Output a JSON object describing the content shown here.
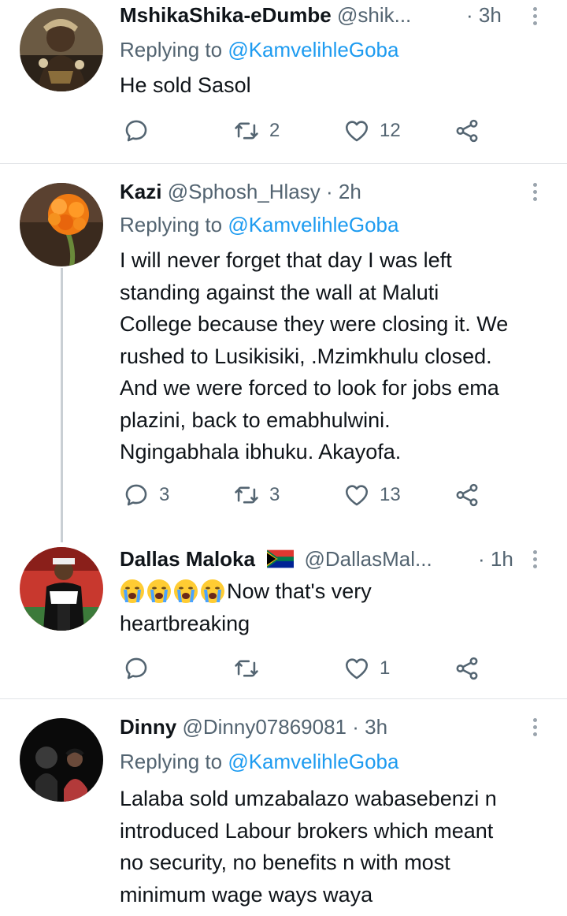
{
  "tweets": [
    {
      "name": "MshikaShika-eDumbe",
      "handle": "@shik...",
      "time": "· 3h",
      "replying_label": "Replying to",
      "replying_to": "@KamvelihleGoba",
      "text": "He sold Sasol",
      "reply_count": "",
      "retweet_count": "2",
      "like_count": "12"
    },
    {
      "name": "Kazi",
      "handle": "@Sphosh_Hlasy",
      "time": "· 2h",
      "replying_label": "Replying to",
      "replying_to": "@KamvelihleGoba",
      "text_lines": [
        "I will never forget that day I was left",
        "standing against the wall at Maluti",
        "College because they were closing it. We",
        "rushed to Lusikisiki, .Mzimkhulu closed.",
        "And we were forced to look for  jobs ema",
        "plazini, back to emabhulwini.",
        "Ngingabhala ibhuku. Akayofa."
      ],
      "reply_count": "3",
      "retweet_count": "3",
      "like_count": "13"
    },
    {
      "name": "Dallas Maloka",
      "handle": "@DallasMal...",
      "time": "· 1h",
      "text_after_emoji": "Now that's very",
      "text_line2": "heartbreaking",
      "reply_count": "",
      "retweet_count": "",
      "like_count": "1"
    },
    {
      "name": "Dinny",
      "handle": "@Dinny07869081",
      "time": "· 3h",
      "replying_label": "Replying to",
      "replying_to": "@KamvelihleGoba",
      "text_lines": [
        "Lalaba sold umzabalazo wabasebenzi n",
        "introduced Labour brokers which meant",
        "no security, no benefits n with most",
        "minimum wage ways waya"
      ]
    }
  ],
  "colors": {
    "text": "#0f1419",
    "secondary": "#536471",
    "link": "#1d9bf0",
    "divider": "#e1e4e7",
    "thread_line": "#c9cfd4"
  },
  "icons": [
    "reply-icon",
    "retweet-icon",
    "like-icon",
    "share-icon",
    "more-options-icon",
    "south-africa-flag-icon",
    "crying-face-emoji"
  ]
}
